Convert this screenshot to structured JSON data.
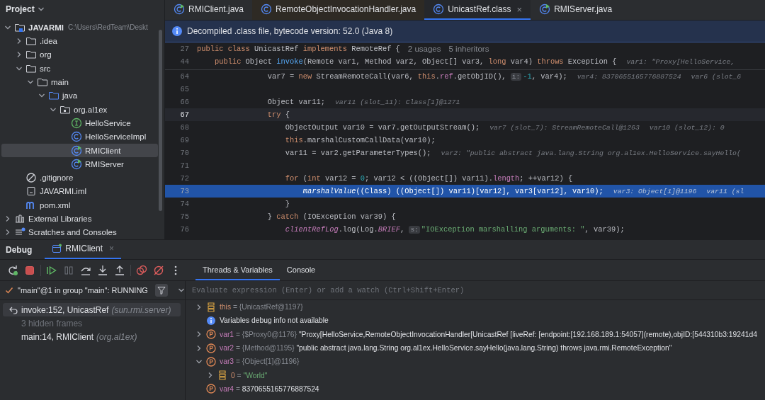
{
  "project": {
    "title": "Project",
    "tree": [
      {
        "name": "JAVARMI",
        "path": "C:\\Users\\RedTeam\\Deskt",
        "kind": "module",
        "expanded": true,
        "selected": false,
        "children": [
          {
            "name": ".idea",
            "kind": "folder",
            "expanded": false,
            "selected": false
          },
          {
            "name": "org",
            "kind": "folder",
            "expanded": false,
            "selected": false
          },
          {
            "name": "src",
            "kind": "folder",
            "expanded": true,
            "selected": false,
            "children": [
              {
                "name": "main",
                "kind": "folder",
                "expanded": true,
                "selected": false,
                "children": [
                  {
                    "name": "java",
                    "kind": "source-folder",
                    "expanded": true,
                    "selected": false,
                    "children": [
                      {
                        "name": "org.al1ex",
                        "kind": "package",
                        "expanded": true,
                        "selected": false,
                        "children": [
                          {
                            "name": "HelloService",
                            "kind": "interface",
                            "selected": false
                          },
                          {
                            "name": "HelloServiceImpl",
                            "kind": "class",
                            "selected": false
                          },
                          {
                            "name": "RMIClient",
                            "kind": "runnable-class",
                            "selected": true
                          },
                          {
                            "name": "RMIServer",
                            "kind": "runnable-class",
                            "selected": false
                          }
                        ]
                      }
                    ]
                  }
                ]
              }
            ]
          },
          {
            "name": ".gitignore",
            "kind": "ignore",
            "selected": false
          },
          {
            "name": "JAVARMI.iml",
            "kind": "iml",
            "selected": false
          },
          {
            "name": "pom.xml",
            "kind": "maven",
            "selected": false
          }
        ]
      },
      {
        "name": "External Libraries",
        "kind": "libraries",
        "expanded": false,
        "selected": false
      },
      {
        "name": "Scratches and Consoles",
        "kind": "scratches",
        "expanded": false,
        "selected": false
      }
    ]
  },
  "editor": {
    "tabs": [
      {
        "label": "RMIClient.java",
        "kind": "runnable-class",
        "selected": false,
        "closable": false
      },
      {
        "label": "RemoteObjectInvocationHandler.java",
        "kind": "class",
        "selected": false,
        "closable": false
      },
      {
        "label": "UnicastRef.class",
        "kind": "class",
        "selected": true,
        "closable": true
      },
      {
        "label": "RMIServer.java",
        "kind": "runnable-class",
        "selected": false,
        "closable": false
      }
    ],
    "close_glyph": "×",
    "banner": "Decompiled .class file, bytecode version: 52.0 (Java 8)",
    "sticky_lines": [
      {
        "number": "27",
        "segments": [
          {
            "kind": "kw",
            "text": "public class "
          },
          {
            "kind": "plain",
            "text": "UnicastRef "
          },
          {
            "kind": "kw",
            "text": "implements "
          },
          {
            "kind": "plain",
            "text": "RemoteRef {"
          },
          {
            "kind": "usage",
            "text": "2 usages"
          },
          {
            "kind": "usage",
            "text": "5 inheritors"
          }
        ]
      },
      {
        "number": "44",
        "segments": [
          {
            "kind": "kw",
            "text": "    public "
          },
          {
            "kind": "plain",
            "text": "Object "
          },
          {
            "kind": "fn",
            "text": "invoke"
          },
          {
            "kind": "plain",
            "text": "(Remote var1, Method var2, Object[] var3, "
          },
          {
            "kind": "kw",
            "text": "long "
          },
          {
            "kind": "plain",
            "text": "var4) "
          },
          {
            "kind": "kw",
            "text": "throws "
          },
          {
            "kind": "plain",
            "text": "Exception {"
          },
          {
            "kind": "hint",
            "text": "var1: \"Proxy[HelloService,"
          }
        ]
      }
    ],
    "lines": [
      {
        "number": "64",
        "current": false,
        "caret": false,
        "segments": [
          {
            "kind": "plain",
            "text": "                var7 = "
          },
          {
            "kind": "kw",
            "text": "new "
          },
          {
            "kind": "plain",
            "text": "StreamRemoteCall(var6, "
          },
          {
            "kind": "kw",
            "text": "this"
          },
          {
            "kind": "plain",
            "text": "."
          },
          {
            "kind": "field",
            "text": "ref"
          },
          {
            "kind": "plain",
            "text": ".getObjID(), "
          },
          {
            "kind": "chip",
            "text": "i:"
          },
          {
            "kind": "num",
            "text": "-1"
          },
          {
            "kind": "plain",
            "text": ", var4);"
          },
          {
            "kind": "hint",
            "text": "var4: 8370655165776887524"
          },
          {
            "kind": "hint",
            "text": "var6 (slot_6"
          }
        ]
      },
      {
        "number": "65",
        "current": false,
        "caret": false
      },
      {
        "number": "66",
        "current": false,
        "caret": false,
        "segments": [
          {
            "kind": "plain",
            "text": "                Object var11;"
          },
          {
            "kind": "hint",
            "text": "var11 (slot_11): Class[1]@1271"
          }
        ]
      },
      {
        "number": "67",
        "current": false,
        "caret": true,
        "segments": [
          {
            "kind": "kw",
            "text": "                try "
          },
          {
            "kind": "plain",
            "text": "{"
          }
        ]
      },
      {
        "number": "68",
        "current": false,
        "caret": false,
        "segments": [
          {
            "kind": "plain",
            "text": "                    ObjectOutput var10 = var7.getOutputStream();"
          },
          {
            "kind": "hint",
            "text": "var7 (slot_7): StreamRemoteCall@1263"
          },
          {
            "kind": "hint",
            "text": "var10 (slot_12): 0"
          }
        ]
      },
      {
        "number": "69",
        "current": false,
        "caret": false,
        "segments": [
          {
            "kind": "kw",
            "text": "                    this"
          },
          {
            "kind": "plain",
            "text": ".marshalCustomCallData(var10);"
          }
        ]
      },
      {
        "number": "70",
        "current": false,
        "caret": false,
        "segments": [
          {
            "kind": "plain",
            "text": "                    var11 = var2.getParameterTypes();"
          },
          {
            "kind": "hint",
            "text": "var2: \"public abstract java.lang.String org.al1ex.HelloService.sayHello("
          }
        ]
      },
      {
        "number": "71",
        "current": false,
        "caret": false
      },
      {
        "number": "72",
        "current": false,
        "caret": false,
        "segments": [
          {
            "kind": "kw",
            "text": "                    for "
          },
          {
            "kind": "plain",
            "text": "("
          },
          {
            "kind": "kw",
            "text": "int "
          },
          {
            "kind": "plain",
            "text": "var12 = "
          },
          {
            "kind": "num",
            "text": "0"
          },
          {
            "kind": "plain",
            "text": "; var12 < ((Object[]) var11)."
          },
          {
            "kind": "field",
            "text": "length"
          },
          {
            "kind": "plain",
            "text": "; ++var12) {"
          }
        ]
      },
      {
        "number": "73",
        "current": true,
        "caret": false,
        "segments": [
          {
            "kind": "call",
            "text": "                        marshalValue"
          },
          {
            "kind": "plain",
            "text": "((Class) ((Object[]) var11)[var12], var3[var12], var10);"
          },
          {
            "kind": "hint",
            "text": "var3: Object[1]@1196"
          },
          {
            "kind": "hint",
            "text": "var11 (sl"
          }
        ]
      },
      {
        "number": "74",
        "current": false,
        "caret": false,
        "segments": [
          {
            "kind": "plain",
            "text": "                    }"
          }
        ]
      },
      {
        "number": "75",
        "current": false,
        "caret": false,
        "segments": [
          {
            "kind": "plain",
            "text": "                } "
          },
          {
            "kind": "kw",
            "text": "catch "
          },
          {
            "kind": "plain",
            "text": "(IOException var39) {"
          }
        ]
      },
      {
        "number": "76",
        "current": false,
        "caret": false,
        "segments": [
          {
            "kind": "static",
            "text": "                    clientRefLog"
          },
          {
            "kind": "plain",
            "text": ".log(Log."
          },
          {
            "kind": "sfield",
            "text": "BRIEF"
          },
          {
            "kind": "plain",
            "text": ", "
          },
          {
            "kind": "chip",
            "text": "s:"
          },
          {
            "kind": "str",
            "text": "\"IOException marshalling arguments: \""
          },
          {
            "kind": "plain",
            "text": ", var39);"
          }
        ]
      }
    ]
  },
  "debug": {
    "title": "Debug",
    "session_tab": {
      "label": "RMIClient",
      "selected": true
    },
    "close_glyph": "×",
    "tabs": [
      {
        "label": "Threads & Variables",
        "selected": true
      },
      {
        "label": "Console",
        "selected": false
      }
    ],
    "thread": "\"main\"@1 in group \"main\": RUNNING",
    "frames": [
      {
        "kind": "frame",
        "method": "invoke:152, UnicastRef",
        "package": "(sun.rmi.server)",
        "selected": true
      },
      {
        "kind": "hidden",
        "method": "3 hidden frames",
        "selected": false
      },
      {
        "kind": "frame",
        "method": "main:14, RMIClient",
        "package": "(org.al1ex)",
        "selected": false
      }
    ],
    "separator": "=",
    "evaluate_placeholder": "Evaluate expression (Enter) or add a watch (Ctrl+Shift+Enter)",
    "variables": [
      {
        "kind": "field",
        "name": "this",
        "type": "{UnicastRef@1197}",
        "expanded": false
      },
      {
        "kind": "info",
        "text": "Variables debug info not available"
      },
      {
        "kind": "param",
        "name": "var1",
        "type": "{$Proxy0@1176}",
        "value": "\"Proxy[HelloService,RemoteObjectInvocationHandler[UnicastRef [liveRef: [endpoint:[192.168.189.1:54057](remote),objID:[544310b3:19241d4",
        "expanded": false
      },
      {
        "kind": "param",
        "name": "var2",
        "type": "{Method@1195}",
        "value": "\"public abstract java.lang.String org.al1ex.HelloService.sayHello(java.lang.String) throws java.rmi.RemoteException\"",
        "expanded": false
      },
      {
        "kind": "param",
        "name": "var3",
        "type": "{Object[1]@1196}",
        "expanded": true,
        "children": [
          {
            "kind": "element",
            "name": "0",
            "value": "\"World\"",
            "expanded": false
          }
        ]
      },
      {
        "kind": "param",
        "name": "var4",
        "value": "8370655165776887524"
      }
    ]
  }
}
